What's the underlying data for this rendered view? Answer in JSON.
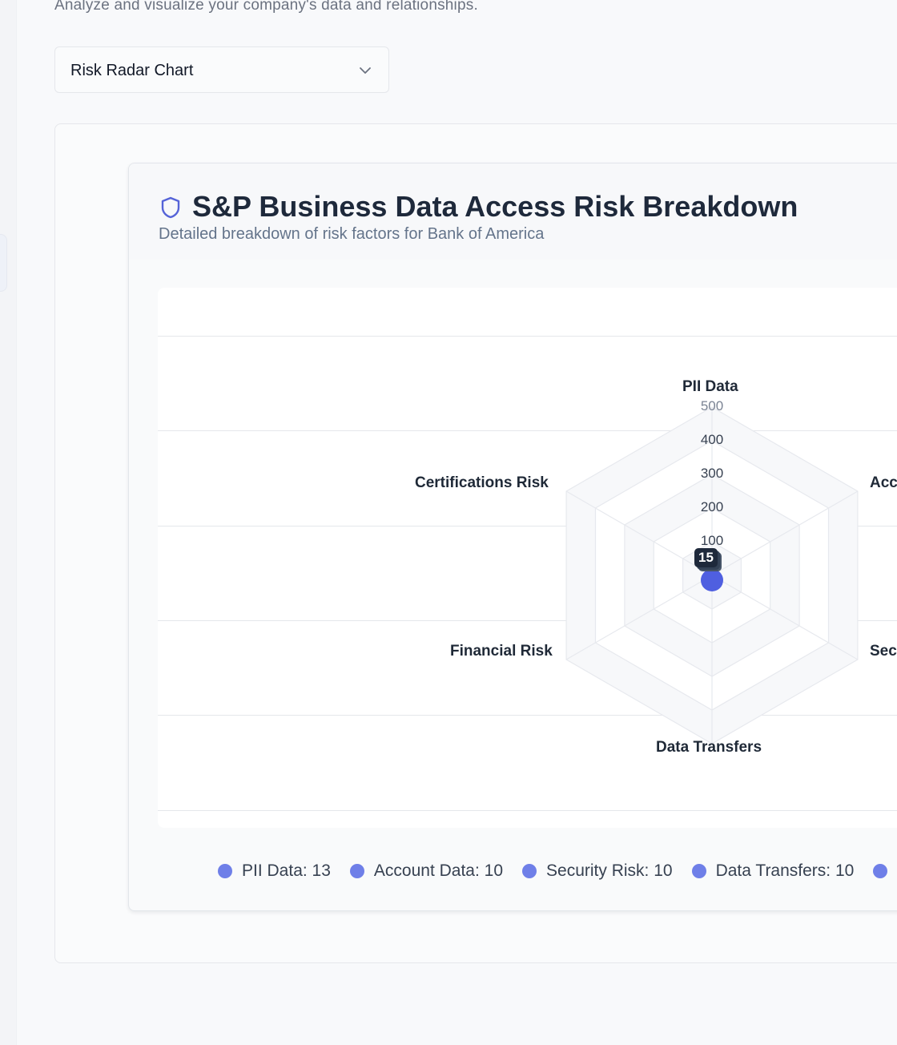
{
  "page": {
    "subtitle": "Analyze and visualize your company's data and relationships."
  },
  "view_select": {
    "value": "Risk Radar Chart",
    "icon": "chevron-down-icon"
  },
  "card": {
    "title": "S&P Business Data Access Risk Breakdown",
    "subtitle": "Detailed breakdown of risk factors for Bank of America",
    "icon": "shield-icon"
  },
  "chart_data": {
    "type": "radar",
    "axes": [
      "PII Data",
      "Account Data",
      "Security Risk",
      "Data Transfers",
      "Financial Risk",
      "Certifications Risk"
    ],
    "axis_labels_visible": [
      "PII Data",
      "Acc",
      "Sec",
      "Data Transfers",
      "Financial Risk",
      "Certifications Risk"
    ],
    "radial_ticks": [
      "100",
      "200",
      "300",
      "400",
      "500"
    ],
    "rmax": 500,
    "series": [
      {
        "values": [
          13,
          10,
          10,
          10,
          15,
          15
        ]
      }
    ],
    "tooltip_value": "15",
    "accent_color": "#4f5fe0",
    "grid_color": "#e7e9ee"
  },
  "legend": [
    {
      "label": "PII Data: 13",
      "color": "#6f7fe8"
    },
    {
      "label": "Account Data: 10",
      "color": "#6f7fe8"
    },
    {
      "label": "Security Risk: 10",
      "color": "#6f7fe8"
    },
    {
      "label": "Data Transfers: 10",
      "color": "#6f7fe8"
    },
    {
      "label": "",
      "color": "#6f7fe8"
    }
  ]
}
